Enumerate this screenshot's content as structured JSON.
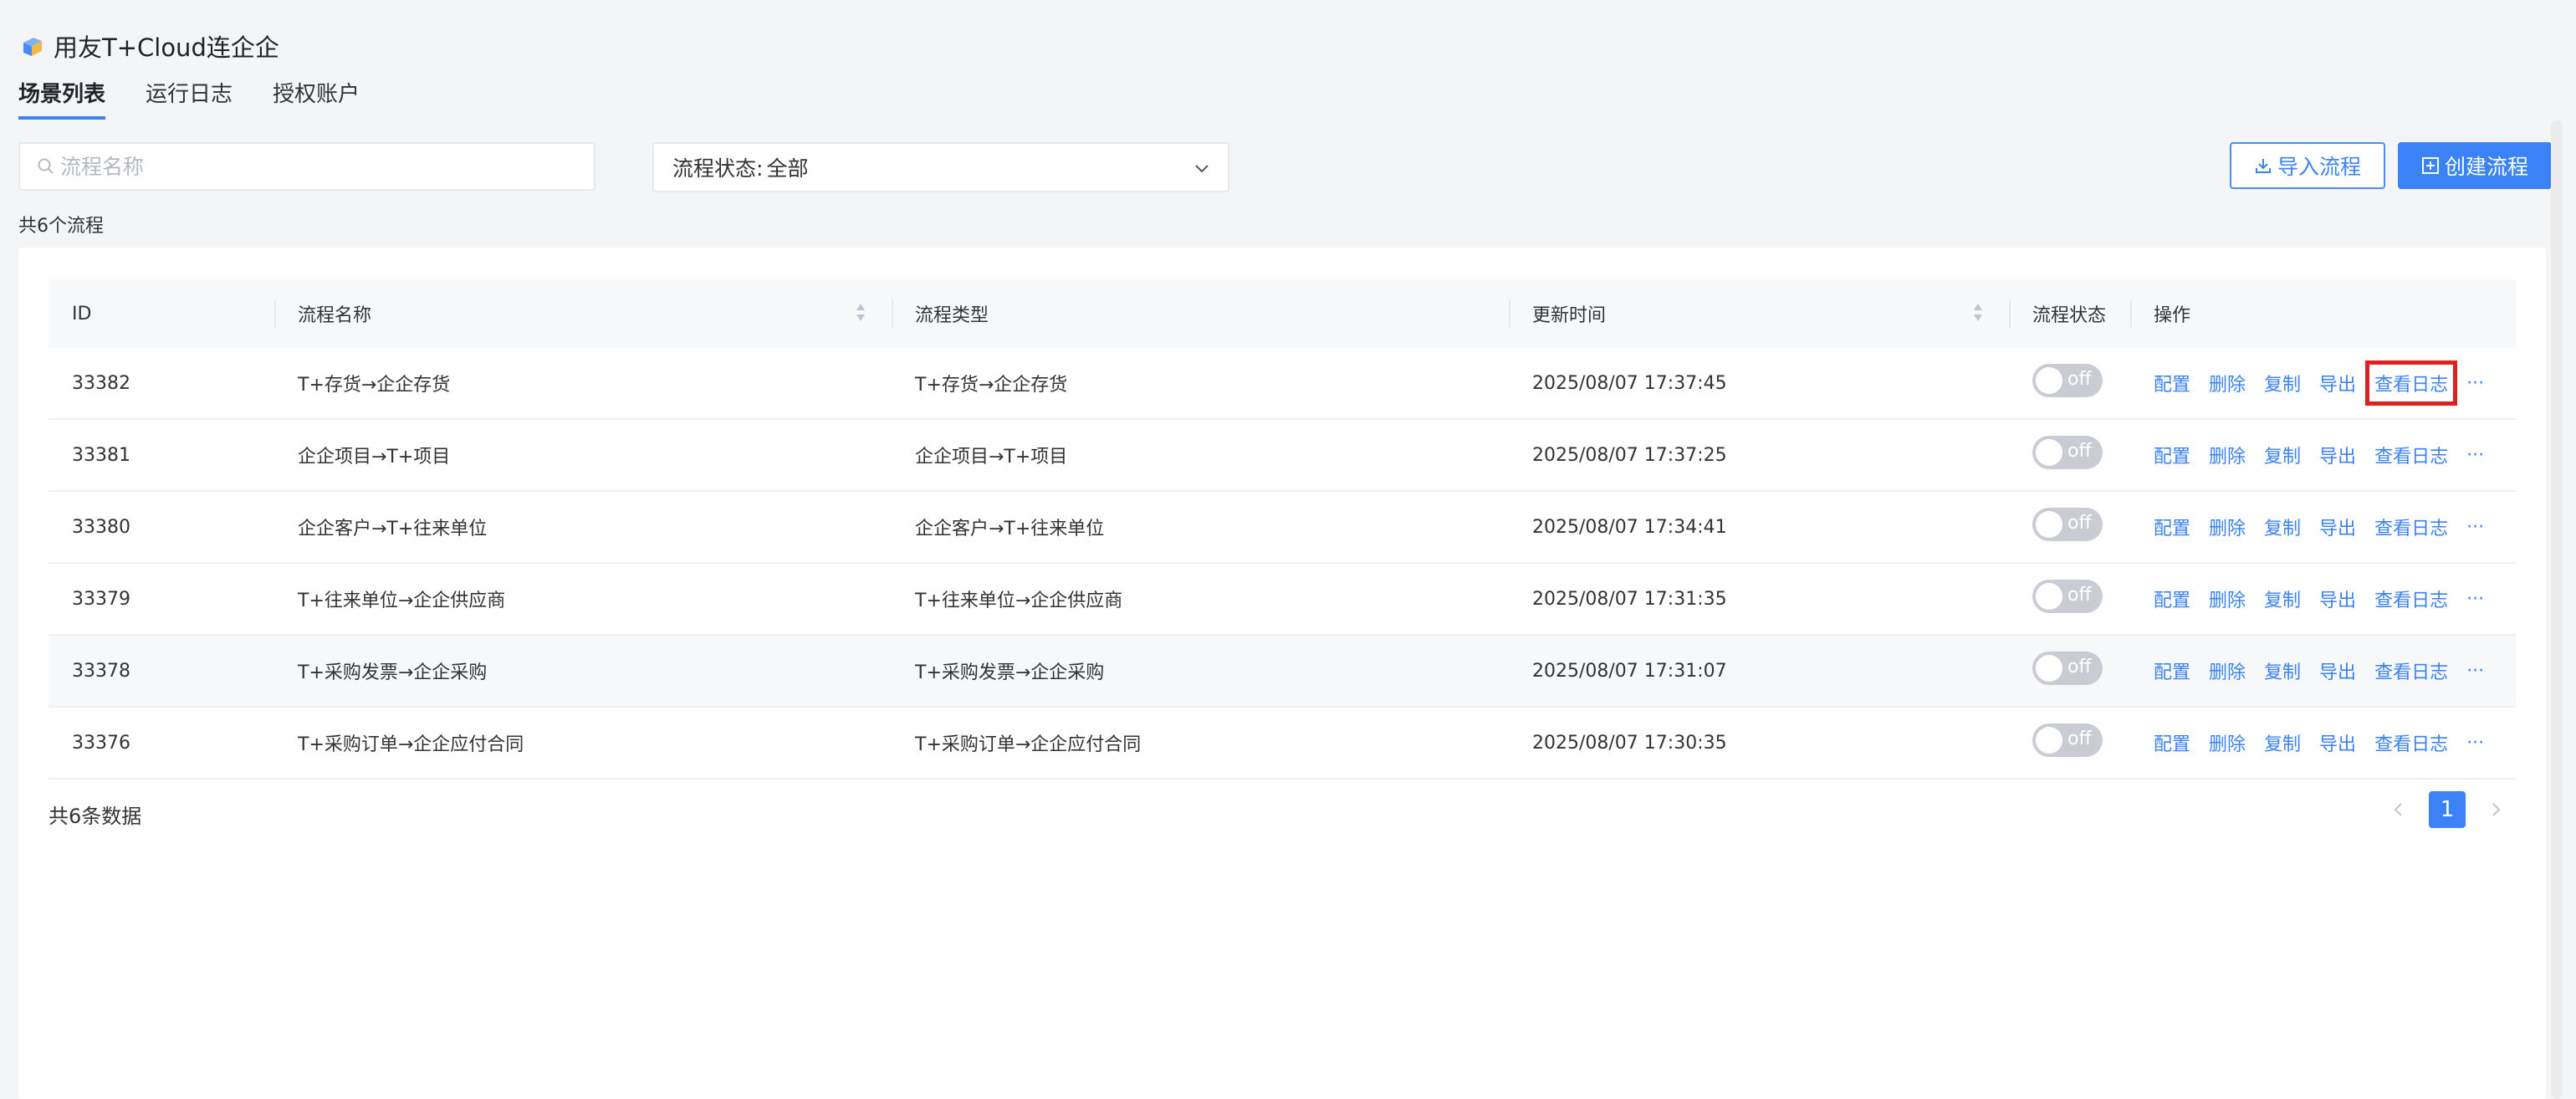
{
  "app": {
    "title": "用友T+Cloud连企企"
  },
  "tabs": [
    {
      "label": "场景列表",
      "active": true
    },
    {
      "label": "运行日志"
    },
    {
      "label": "授权账户"
    }
  ],
  "search": {
    "placeholder": "流程名称",
    "value": ""
  },
  "status_filter": {
    "label": "流程状态:",
    "value": "全部"
  },
  "buttons": {
    "import": "导入流程",
    "create": "创建流程"
  },
  "flow_count": "共6个流程",
  "table": {
    "headers": [
      "ID",
      "流程名称",
      "流程类型",
      "更新时间",
      "流程状态",
      "操作"
    ],
    "rows": [
      {
        "id": "33382",
        "name": "T+存货→企企存货",
        "type": "T+存货→企企存货",
        "updated": "2025/08/07 17:37:45",
        "status": "off"
      },
      {
        "id": "33381",
        "name": "企企项目→T+项目",
        "type": "企企项目→T+项目",
        "updated": "2025/08/07 17:37:25",
        "status": "off"
      },
      {
        "id": "33380",
        "name": "企企客户→T+往来单位",
        "type": "企企客户→T+往来单位",
        "updated": "2025/08/07 17:34:41",
        "status": "off"
      },
      {
        "id": "33379",
        "name": "T+往来单位→企企供应商",
        "type": "T+往来单位→企企供应商",
        "updated": "2025/08/07 17:31:35",
        "status": "off"
      },
      {
        "id": "33378",
        "name": "T+采购发票→企企采购",
        "type": "T+采购发票→企企采购",
        "updated": "2025/08/07 17:31:07",
        "status": "off"
      },
      {
        "id": "33376",
        "name": "T+采购订单→企企应付合同",
        "type": "T+采购订单→企企应付合同",
        "updated": "2025/08/07 17:30:35",
        "status": "off"
      }
    ],
    "actions": [
      "配置",
      "删除",
      "复制",
      "导出",
      "查看日志"
    ],
    "more": "···"
  },
  "footer": {
    "total": "共6条数据",
    "current_page": "1"
  },
  "colors": {
    "accent": "#3b82f6",
    "highlight_box": "#e02020"
  }
}
